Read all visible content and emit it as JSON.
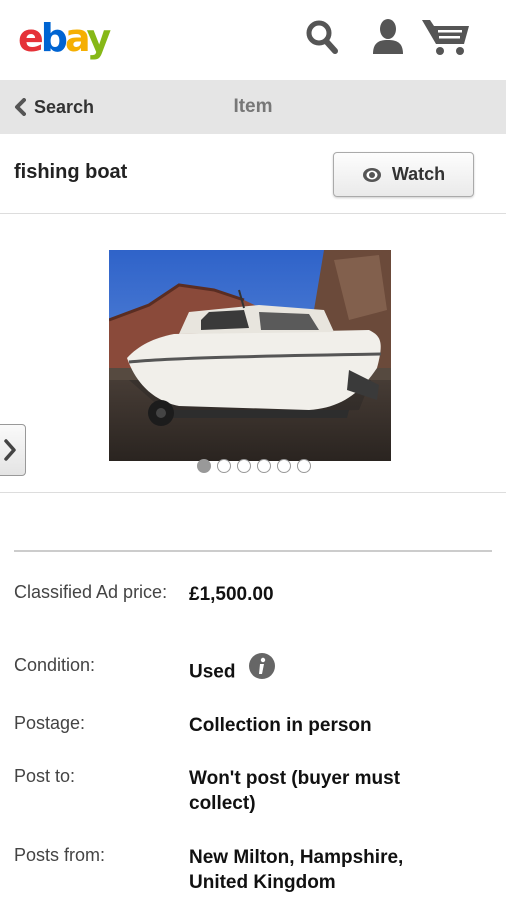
{
  "header": {
    "logo": {
      "e": "e",
      "b": "b",
      "a": "a",
      "y": "y"
    },
    "icons": [
      "search-icon",
      "account-icon",
      "cart-icon"
    ]
  },
  "nav": {
    "back_label": "Search",
    "title": "Item"
  },
  "item": {
    "title": "fishing boat",
    "watch_label": "Watch"
  },
  "gallery": {
    "image_count": 6,
    "active_index": 0
  },
  "details": [
    {
      "label": "Classified Ad price:",
      "value": "£1,500.00"
    },
    {
      "label": "Condition:",
      "value": "Used"
    },
    {
      "label": "Postage:",
      "value": "Collection in person"
    },
    {
      "label": "Post to:",
      "value": "Won't post (buyer must collect)"
    },
    {
      "label": "Posts from:",
      "value": "New Milton, Hampshire, United Kingdom"
    }
  ],
  "colors": {
    "logo_red": "#e53238",
    "logo_blue": "#0064d2",
    "logo_yellow": "#f5af02",
    "logo_green": "#86b817",
    "icon_gray": "#555555",
    "navbar_bg": "#e5e5e5"
  }
}
